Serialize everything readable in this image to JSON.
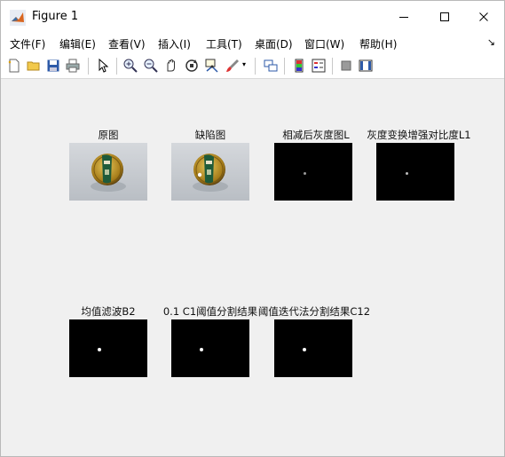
{
  "window": {
    "title": "Figure 1",
    "controls": {
      "minimize": "minimize-icon",
      "maximize": "maximize-icon",
      "close": "close-icon"
    }
  },
  "menu": {
    "items": [
      "文件(F)",
      "编辑(E)",
      "查看(V)",
      "插入(I)",
      "工具(T)",
      "桌面(D)",
      "窗口(W)",
      "帮助(H)"
    ],
    "overflow_icon": "arrow-icon"
  },
  "toolbar": {
    "icons": [
      "new-figure-icon",
      "open-file-icon",
      "save-icon",
      "print-icon",
      "select-arrow-icon",
      "zoom-in-icon",
      "zoom-out-icon",
      "pan-icon",
      "rotate-3d-icon",
      "data-cursor-icon",
      "brush-icon",
      "link-plot-icon",
      "colorbar-icon",
      "legend-icon",
      "hide-plot-tools-icon",
      "show-plot-tools-icon"
    ]
  },
  "subplots": [
    {
      "title": "原图"
    },
    {
      "title": "缺陷图"
    },
    {
      "title": "相减后灰度图L"
    },
    {
      "title": "灰度变换增强对比度L1"
    },
    {
      "title": "均值滤波B2"
    },
    {
      "title": "0.1 C1阈值分割结果"
    },
    {
      "title": "阈值迭代法分割结果C12"
    }
  ],
  "colors": {
    "canvas": "#f0f0f0",
    "cap_gold": "#b08a1e",
    "cap_green": "#1f5b3a",
    "image_bg": "#c8ccd0"
  }
}
